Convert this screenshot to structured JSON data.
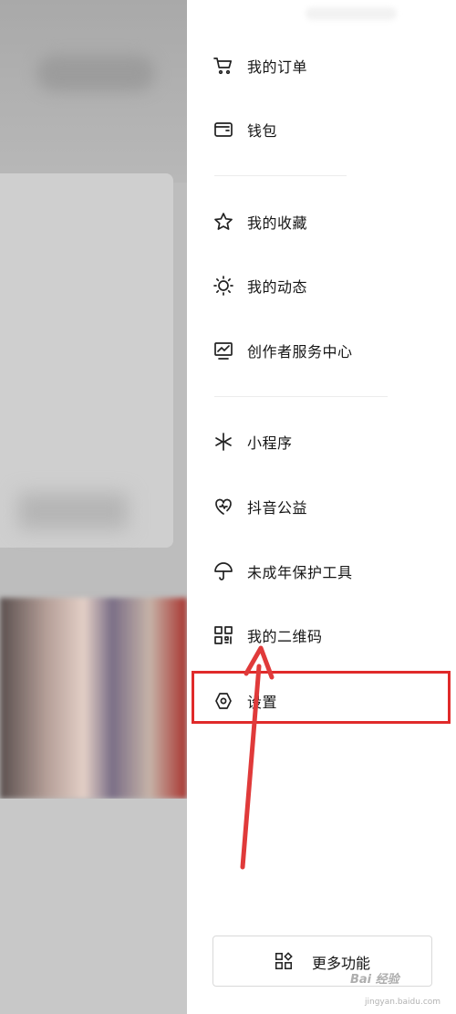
{
  "drawer": {
    "menu_top": [
      {
        "label": "我的订单",
        "icon": "cart-icon"
      },
      {
        "label": "钱包",
        "icon": "wallet-icon"
      }
    ],
    "menu_mid": [
      {
        "label": "我的收藏",
        "icon": "star-icon"
      },
      {
        "label": "我的动态",
        "icon": "sun-icon"
      },
      {
        "label": "创作者服务中心",
        "icon": "chart-icon"
      }
    ],
    "menu_bottom": [
      {
        "label": "小程序",
        "icon": "mini-program-icon"
      },
      {
        "label": "抖音公益",
        "icon": "charity-heart-icon"
      },
      {
        "label": "未成年保护工具",
        "icon": "umbrella-icon"
      },
      {
        "label": "我的二维码",
        "icon": "qr-code-icon"
      },
      {
        "label": "设置",
        "icon": "settings-hexagon-icon"
      }
    ],
    "more_button": {
      "label": "更多功能",
      "icon": "grid-apps-icon"
    }
  },
  "annotation": {
    "highlight_color": "#e02a2a",
    "target": "设置"
  },
  "watermark": {
    "text": "Bai 经验",
    "sub": "jingyan.baidu.com"
  }
}
